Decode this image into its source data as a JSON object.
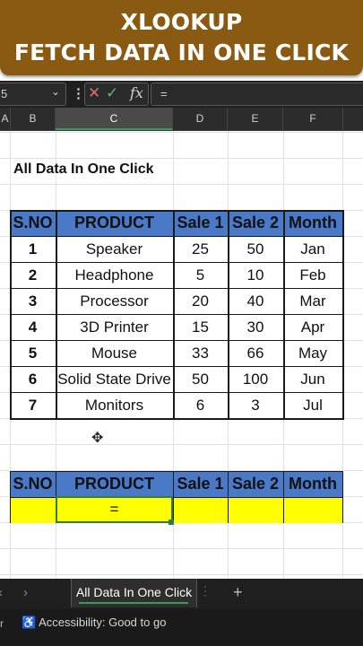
{
  "banner": {
    "line1": "XLOOKUP",
    "line2": "FETCH DATA IN ONE CLICK"
  },
  "formula_bar": {
    "name_box": "5",
    "name_box_arrow": "⌄",
    "cancel_icon": "✕",
    "enter_icon": "✓",
    "fx_label": "fx",
    "formula": "="
  },
  "columns": [
    "A",
    "B",
    "C",
    "D",
    "E",
    "F"
  ],
  "sheet_title": "All Data In One Click",
  "table": {
    "headers": [
      "S.NO",
      "PRODUCT",
      "Sale 1",
      "Sale 2",
      "Month"
    ],
    "rows": [
      [
        "1",
        "Speaker",
        "25",
        "50",
        "Jan"
      ],
      [
        "2",
        "Headphone",
        "5",
        "10",
        "Feb"
      ],
      [
        "3",
        "Processor",
        "20",
        "40",
        "Mar"
      ],
      [
        "4",
        "3D Printer",
        "15",
        "30",
        "Apr"
      ],
      [
        "5",
        "Mouse",
        "33",
        "66",
        "May"
      ],
      [
        "6",
        "Solid State Drive",
        "50",
        "100",
        "Jun"
      ],
      [
        "7",
        "Monitors",
        "6",
        "3",
        "Jul"
      ]
    ]
  },
  "lookup_table": {
    "headers": [
      "S.NO",
      "PRODUCT",
      "Sale 1",
      "Sale 2",
      "Month"
    ],
    "input_row": [
      "",
      "=",
      "",
      "",
      ""
    ]
  },
  "sheet_tabs": {
    "active": "All Data In One Click",
    "add": "+",
    "prev": "‹",
    "next": "›"
  },
  "status_bar": {
    "prefix": "r",
    "accessibility": "Accessibility: Good to go"
  },
  "colors": {
    "banner": "#8a5a12",
    "header_fill": "#4a79c7",
    "input_fill": "#ffff00",
    "accent_green": "#2e7d42"
  }
}
